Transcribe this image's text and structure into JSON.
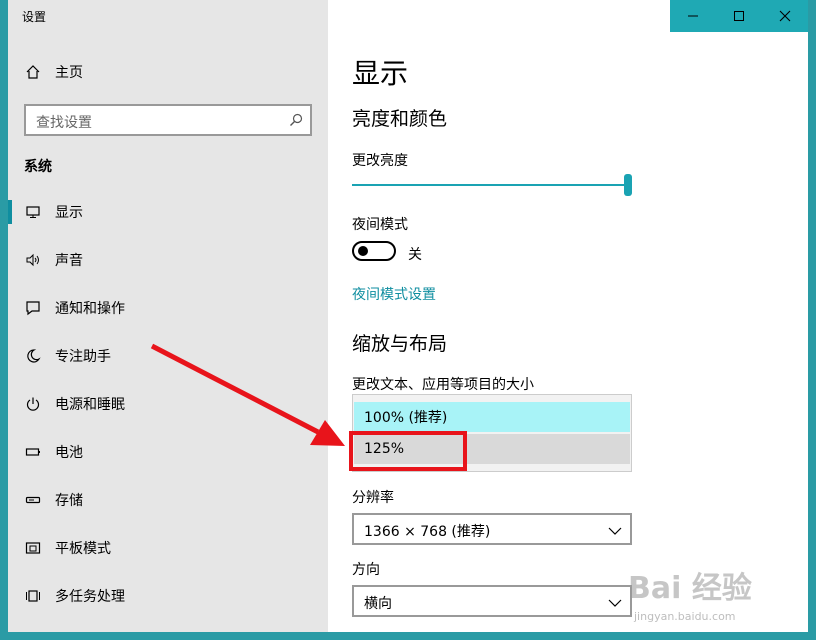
{
  "window": {
    "title": "设置"
  },
  "sidebar": {
    "home": "主页",
    "search_placeholder": "查找设置",
    "section": "系统",
    "items": [
      {
        "label": "显示",
        "icon": "monitor-icon"
      },
      {
        "label": "声音",
        "icon": "speaker-icon"
      },
      {
        "label": "通知和操作",
        "icon": "notification-icon"
      },
      {
        "label": "专注助手",
        "icon": "moon-icon"
      },
      {
        "label": "电源和睡眠",
        "icon": "power-icon"
      },
      {
        "label": "电池",
        "icon": "battery-icon"
      },
      {
        "label": "存储",
        "icon": "storage-icon"
      },
      {
        "label": "平板模式",
        "icon": "tablet-icon"
      },
      {
        "label": "多任务处理",
        "icon": "multitask-icon"
      }
    ]
  },
  "content": {
    "page_title": "显示",
    "brightness_heading": "亮度和颜色",
    "brightness_label": "更改亮度",
    "brightness_level": 0.99,
    "night_mode_label": "夜间模式",
    "night_mode_state": "关",
    "night_mode_link": "夜间模式设置",
    "layout_heading": "缩放与布局",
    "scale_label": "更改文本、应用等项目的大小",
    "scale_options": [
      "100% (推荐)",
      "125%"
    ],
    "resolution_label": "分辨率",
    "resolution_value": "1366 × 768 (推荐)",
    "orientation_label": "方向",
    "orientation_value": "横向"
  },
  "watermark": {
    "text": "Bai 经验",
    "url": "jingyan.baidu.com"
  },
  "colors": {
    "accent": "#1aa3b3",
    "highlight": "#e8141b",
    "selected_option": "#a8f3f7"
  }
}
